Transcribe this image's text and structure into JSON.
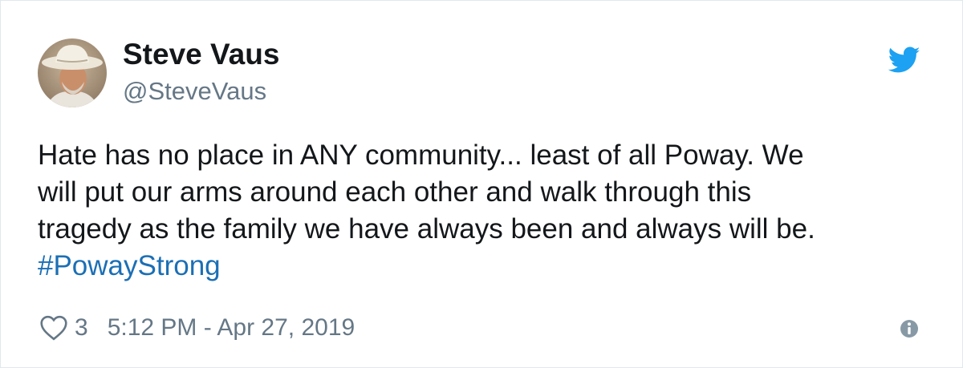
{
  "author": {
    "display_name": "Steve Vaus",
    "handle": "@SteveVaus"
  },
  "tweet": {
    "lines": [
      "Hate has no place in ANY community... least of all Poway. We",
      "will put our arms around each other and walk through this",
      "tragedy as the family we have always been and always will be."
    ],
    "hashtag": "#PowayStrong"
  },
  "footer": {
    "like_count": "3",
    "timestamp": "5:12 PM - Apr 27, 2019"
  },
  "icons": {
    "brand": "twitter-bird-icon",
    "like": "heart-icon",
    "info": "info-icon"
  },
  "colors": {
    "brand_blue": "#1da1f2",
    "hashtag": "#1b6fb5",
    "secondary_text": "#657786"
  }
}
